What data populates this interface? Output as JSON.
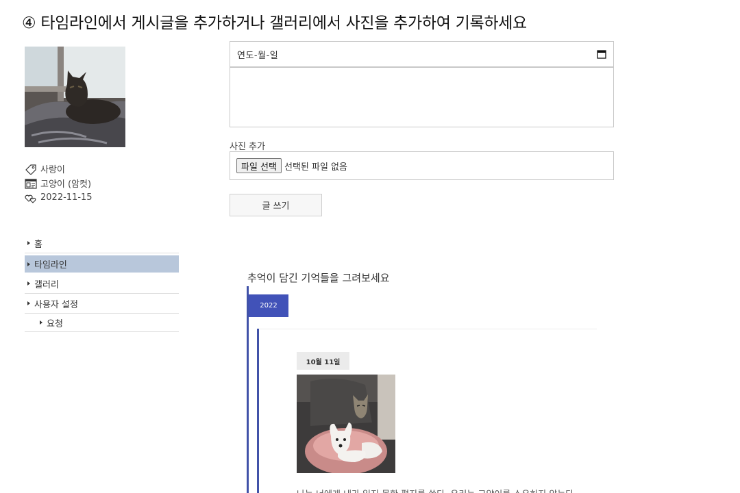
{
  "instruction": "④ 타임라인에서 게시글을 추가하거나 갤러리에서 사진을 추가하여 기록하세요",
  "profile": {
    "name": "사랑이",
    "species": "고양이 (암컷)",
    "date": "2022-11-15"
  },
  "nav": {
    "items": [
      {
        "label": "홈",
        "active": false
      },
      {
        "label": "타임라인",
        "active": true
      },
      {
        "label": "갤러리",
        "active": false
      },
      {
        "label": "사용자 설정",
        "active": false
      }
    ],
    "sub_items": [
      {
        "label": "요청"
      }
    ]
  },
  "form": {
    "date_placeholder": "연도-월-일",
    "photo_label": "사진 추가",
    "file_button": "파일 선택",
    "file_status": "선택된 파일 없음",
    "submit": "글 쓰기"
  },
  "timeline": {
    "title": "추억이 담긴 기억들을 그려보세요",
    "year": "2022",
    "post": {
      "date": "10월 11일",
      "text": "나는 너에게 내가 읽지 못한 편지를 쓴다. 우리는 고양이를 소유하지 않는다"
    }
  },
  "colors": {
    "accent": "#4152b8",
    "nav_active": "#b8c7db"
  }
}
